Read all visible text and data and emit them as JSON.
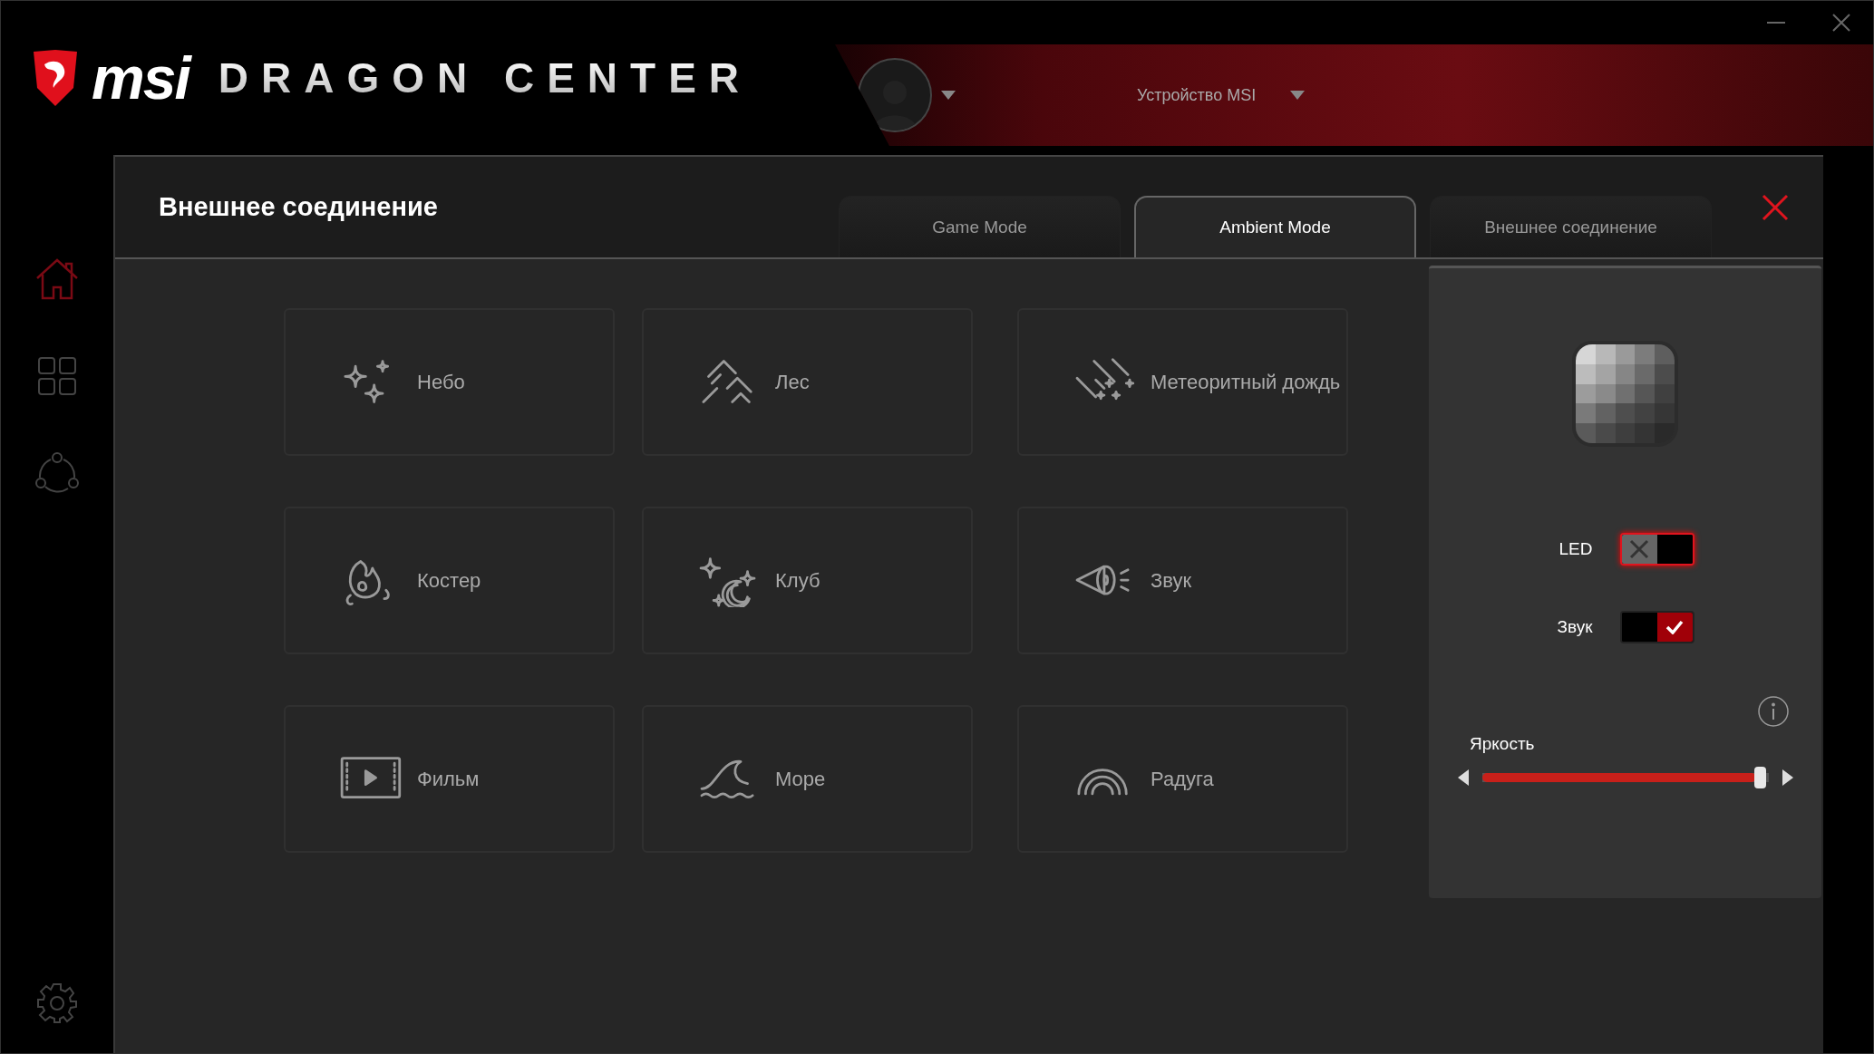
{
  "header": {
    "brand": "msi",
    "product": "DRAGON CENTER",
    "device": "Устройство MSI"
  },
  "sidebar": {
    "items": [
      {
        "selected": true
      },
      {
        "selected": false
      },
      {
        "selected": false
      }
    ]
  },
  "panel": {
    "title": "Внешнее соединение",
    "tabs": [
      {
        "label": "Game Mode",
        "selected": false
      },
      {
        "label": "Ambient Mode",
        "selected": true
      },
      {
        "label": "Внешнее соединение",
        "selected": false
      }
    ],
    "tiles": [
      {
        "label": "Небо",
        "selected": false
      },
      {
        "label": "Лес",
        "selected": false
      },
      {
        "label": "Метеоритный дождь",
        "selected": false
      },
      {
        "label": "Костер",
        "selected": false
      },
      {
        "label": "Клуб",
        "selected": false
      },
      {
        "label": "Звук",
        "selected": false
      },
      {
        "label": "Фильм",
        "selected": false
      },
      {
        "label": "Море",
        "selected": false
      },
      {
        "label": "Радуга",
        "selected": false
      }
    ],
    "settings": {
      "toggles": [
        {
          "label": "LED",
          "on": false,
          "focused": true
        },
        {
          "label": "Звук",
          "on": true,
          "focused": false
        }
      ],
      "brightness": {
        "label": "Яркость",
        "level": 0.98
      }
    }
  }
}
